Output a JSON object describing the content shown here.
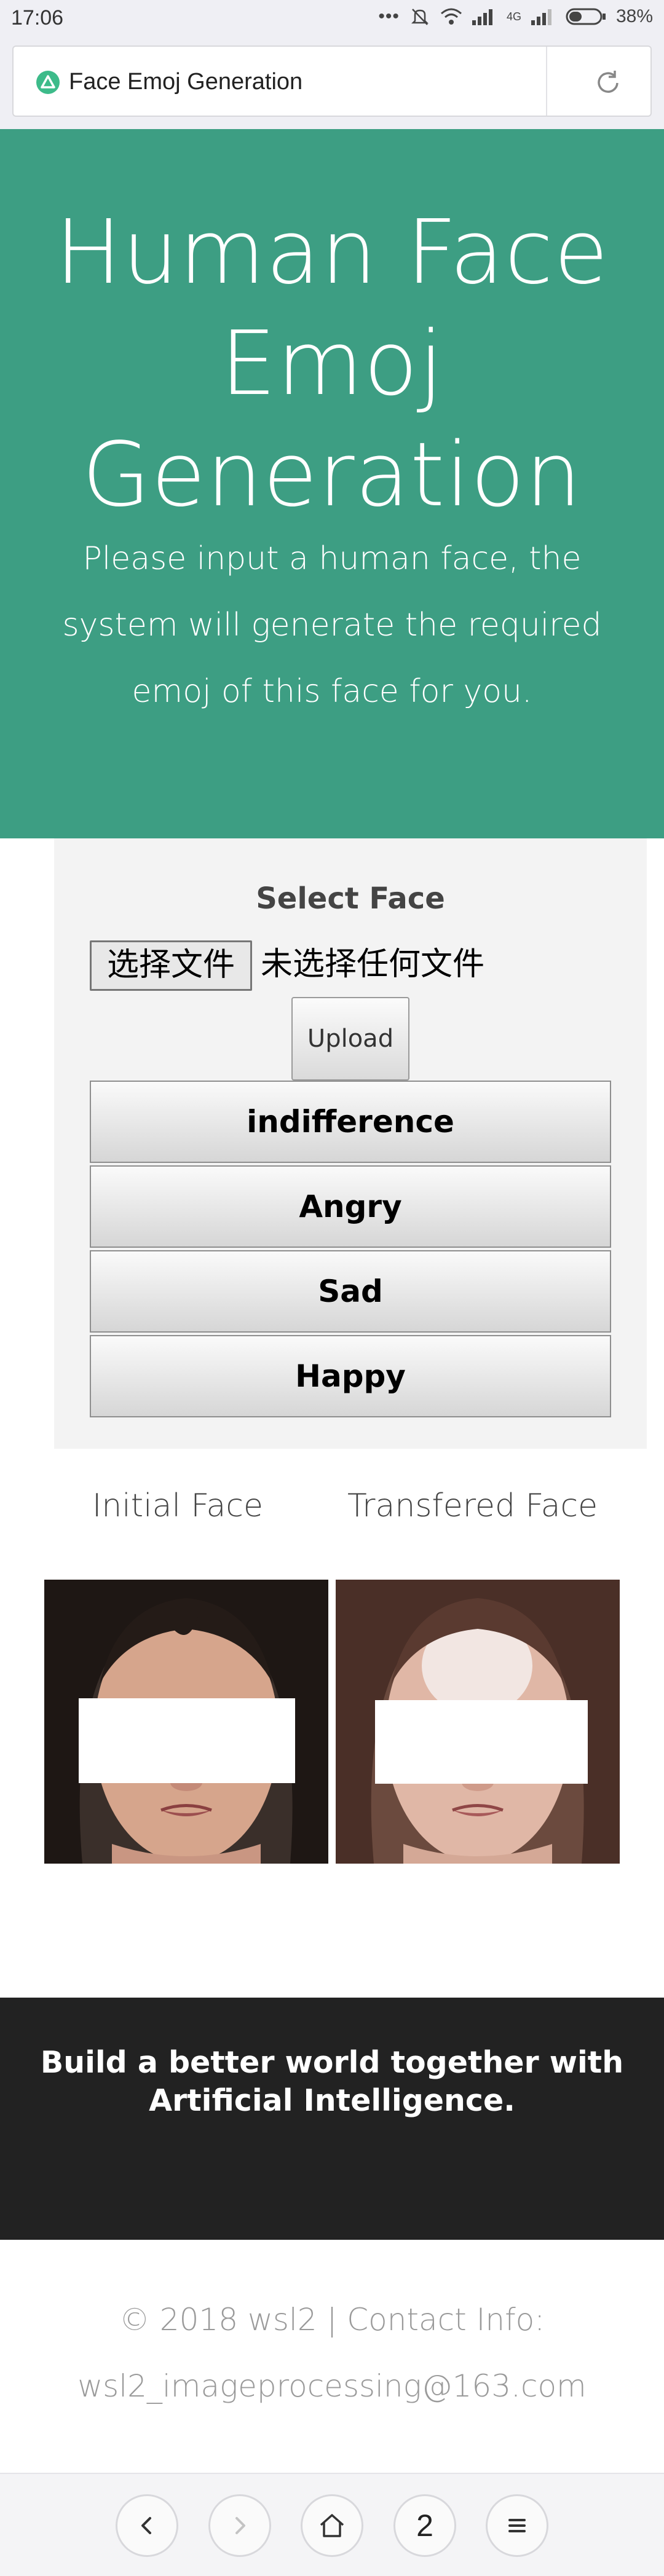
{
  "status_bar": {
    "time": "17:06",
    "network_label": "4G",
    "battery": "38%",
    "icons": [
      "more-icon",
      "mute-icon",
      "wifi-icon",
      "signal-icon",
      "signal-icon",
      "battery-icon"
    ]
  },
  "browser": {
    "page_title": "Face Emoj Generation",
    "site_icon": "site-logo-icon",
    "reload_icon": "reload-icon"
  },
  "hero": {
    "title": "Human Face Emoj Generation",
    "subtitle": "Please input a human face, the system will generate the required emoj of this face for you.",
    "background_color": "#3d9e83"
  },
  "form": {
    "label": "Select Face",
    "file_button": "选择文件",
    "file_status": "未选择任何文件",
    "upload_button": "Upload",
    "emotion_buttons": [
      "indifference",
      "Angry",
      "Sad",
      "Happy"
    ]
  },
  "faces": {
    "initial_label": "Initial Face",
    "transfered_label": "Transfered Face"
  },
  "footer": {
    "tagline": "Build a better world together with Artificial Intelligence.",
    "copyright": "© 2018 wsl2 | Contact Info: wsl2_imageprocessing@163.com"
  },
  "nav": {
    "tab_count": "2",
    "icons": [
      "back-icon",
      "forward-icon",
      "home-icon",
      "tabs-icon",
      "menu-icon"
    ]
  }
}
